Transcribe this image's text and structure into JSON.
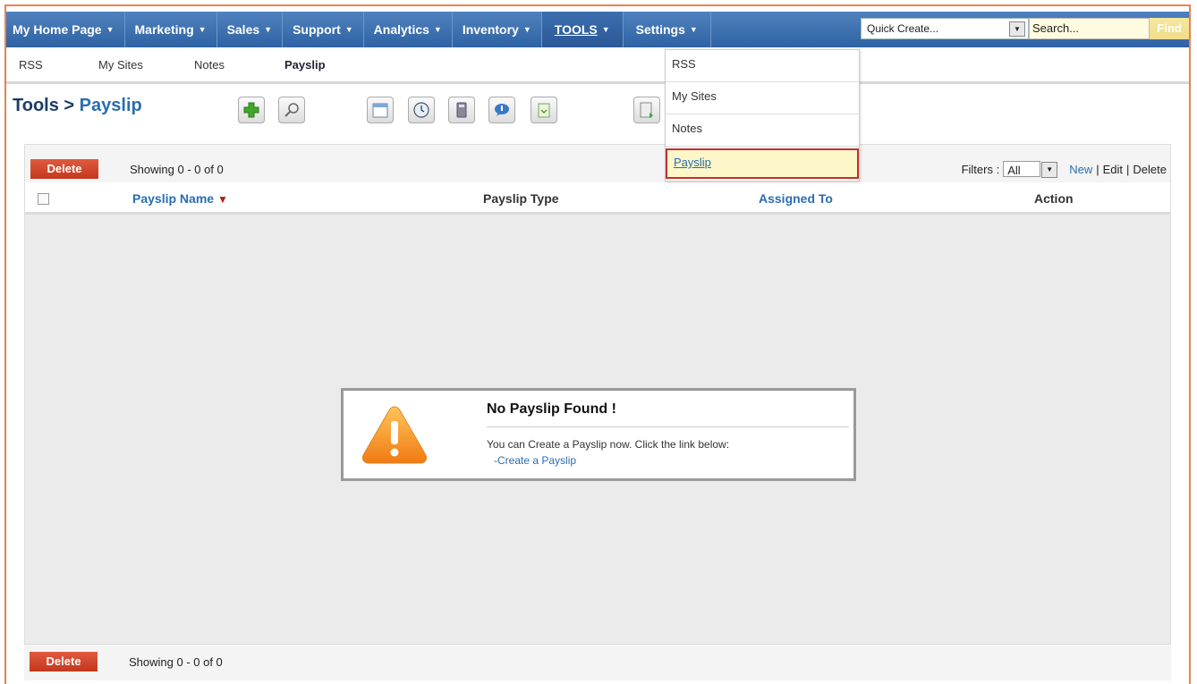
{
  "nav": {
    "tabs": [
      {
        "label": "My Home Page"
      },
      {
        "label": "Marketing"
      },
      {
        "label": "Sales"
      },
      {
        "label": "Support"
      },
      {
        "label": "Analytics"
      },
      {
        "label": "Inventory"
      },
      {
        "label": "TOOLS",
        "active": true
      },
      {
        "label": "Settings"
      }
    ],
    "quick_create": "Quick Create...",
    "search_placeholder": "Search...",
    "find_label": "Find"
  },
  "subnav": {
    "items": [
      "RSS",
      "My Sites",
      "Notes",
      "Payslip"
    ],
    "active": "Payslip"
  },
  "header": {
    "module": "Tools",
    "separator": ">",
    "page": "Payslip"
  },
  "list": {
    "delete_label": "Delete",
    "showing": "Showing 0 - 0 of 0",
    "filters_label": "Filters :",
    "filter_value": "All",
    "new_label": "New",
    "edit_label": "Edit",
    "delete_link_label": "Delete",
    "sep": "|",
    "columns": [
      "Payslip Name",
      "Payslip Type",
      "Assigned To",
      "Action"
    ]
  },
  "empty": {
    "title": "No Payslip Found !",
    "message": "You can Create a Payslip now. Click the link below:",
    "link": "-Create a Payslip"
  },
  "dropdown": {
    "items": [
      "RSS",
      "My Sites",
      "Notes",
      "Payslip"
    ],
    "highlighted": "Payslip"
  },
  "colors": {
    "nav_bg": "#3d6fae",
    "delete_btn": "#d14a2e",
    "link": "#2a6db0",
    "highlight": "#fcf6c8",
    "frame": "#e8834f"
  }
}
